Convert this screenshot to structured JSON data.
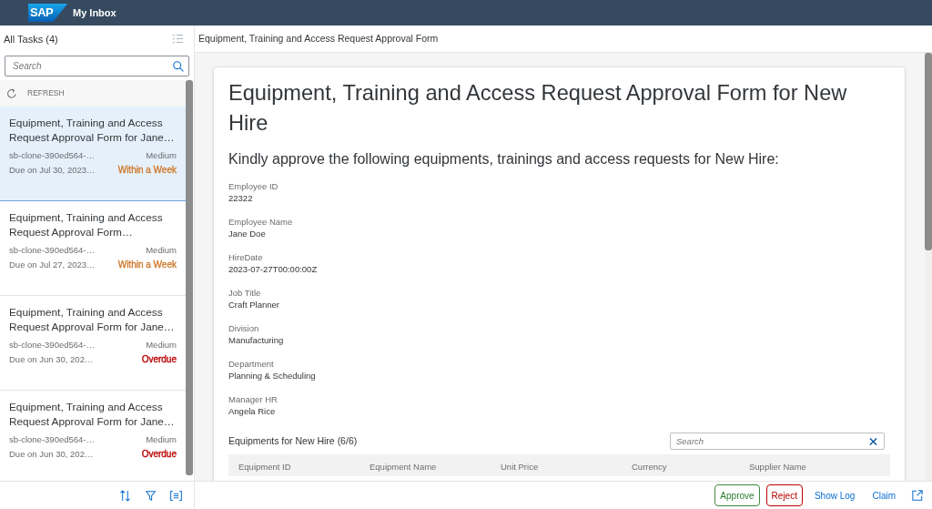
{
  "shell": {
    "logo": "SAP",
    "title": "My Inbox"
  },
  "task_list": {
    "title": "All Tasks (4)",
    "search": {
      "placeholder": "Search"
    },
    "refresh": "REFRESH",
    "items": [
      {
        "title": "Equipment, Training and Access Request Approval Form for Jane…",
        "id": "sb-clone-390ed564-…",
        "priority": "Medium",
        "due": "Due on Jul 30, 2023…",
        "status": "Within a Week",
        "color": "#d0782a",
        "selected": true
      },
      {
        "title": "Equipment, Training and Access Request Approval Form…",
        "id": "sb-clone-390ed564-…",
        "priority": "Medium",
        "due": "Due on Jul 27, 2023…",
        "status": "Within a Week",
        "color": "#d0782a",
        "selected": false
      },
      {
        "title": "Equipment, Training and Access Request Approval Form for Jane…",
        "id": "sb-clone-390ed564-…",
        "priority": "Medium",
        "due": "Due on Jun 30, 202…",
        "status": "Overdue",
        "color": "#bb0000",
        "selected": false
      },
      {
        "title": "Equipment, Training and Access Request Approval Form for Jane…",
        "id": "sb-clone-390ed564-…",
        "priority": "Medium",
        "due": "Due on Jun 30, 202…",
        "status": "Overdue",
        "color": "#bb0000",
        "selected": false
      }
    ]
  },
  "detail": {
    "header_title": "Equipment, Training and Access Request Approval Form",
    "form": {
      "title": "Equipment, Training and Access Request Approval Form for New Hire",
      "subtitle": "Kindly approve the following equipments, trainings and access requests for New Hire:",
      "fields": [
        {
          "label": "Employee ID",
          "value": "22322"
        },
        {
          "label": "Employee Name",
          "value": "Jane Doe"
        },
        {
          "label": "HireDate",
          "value": "2023-07-27T00:00:00Z"
        },
        {
          "label": "Job Title",
          "value": "Craft Planner"
        },
        {
          "label": "Division",
          "value": "Manufacturing"
        },
        {
          "label": "Department",
          "value": "Planning & Scheduling"
        },
        {
          "label": "Manager HR",
          "value": "Angela Rice"
        }
      ],
      "equipments": {
        "title": "Equipments for New Hire (6/6)",
        "search": {
          "placeholder": "Search"
        },
        "columns": [
          "Equipment ID",
          "Equipment Name",
          "Unit Price",
          "Currency",
          "Supplier Name"
        ]
      }
    }
  },
  "footer": {
    "actions": [
      {
        "label": "Approve",
        "kind": "accept"
      },
      {
        "label": "Reject",
        "kind": "reject"
      },
      {
        "label": "Show Log",
        "kind": "transparent"
      },
      {
        "label": "Claim",
        "kind": "transparent"
      }
    ]
  }
}
